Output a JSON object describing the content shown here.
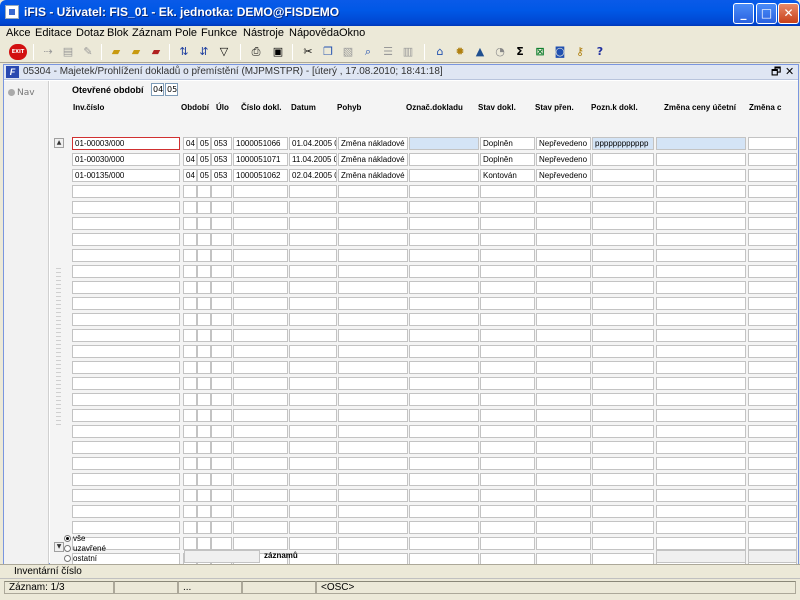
{
  "window": {
    "title": "iFIS - Uživatel: FIS_01 - Ek. jednotka: DEMO@FISDEMO",
    "minimize": "_",
    "maximize": "□",
    "close": "✕"
  },
  "menu": [
    "Akce",
    "Editace",
    "Dotaz",
    "Blok",
    "Záznam",
    "Pole",
    "Funkce",
    "Nástroje",
    "Nápověda",
    "Okno"
  ],
  "toolbar": {
    "exit_label": "EXIT",
    "icons": [
      "exit-icon",
      "import-icon",
      "print-preview-icon",
      "clear-icon",
      "folder-save-icon",
      "folder-lock-icon",
      "folder-delete-icon",
      "sort-ascending-icon",
      "sort-descending-icon",
      "filter-icon",
      "printer-icon",
      "save-icon",
      "cut-icon",
      "copy-icon",
      "paste-icon",
      "search-icon",
      "list-icon",
      "column-icon",
      "tree-icon",
      "settings-icon",
      "triangle-icon",
      "clock-icon",
      "sum-icon",
      "excel-icon",
      "refresh-icon",
      "key-icon",
      "help-icon"
    ],
    "sum_label": "Σ",
    "help_label": "?"
  },
  "form": {
    "title": "05304 - Majetek/Prohlížení dokladů o přemístění (MJPMSTPR) - [úterý , 17.08.2010; 18:41:18]",
    "nav_label": "Nav",
    "period_label": "Otevřené období",
    "period_values": [
      "04",
      "05"
    ],
    "restore_icon": "🗗",
    "close_icon": "✕"
  },
  "table": {
    "columns": [
      "Inv.číslo",
      "Období",
      "Úlo",
      "Číslo dokl.",
      "Datum",
      "Pohyb",
      "Označ.dokladu",
      "Stav dokl.",
      "Stav přen.",
      "Pozn.k dokl.",
      "Změna ceny účetní",
      "Změna c"
    ],
    "rows": [
      [
        "01-00003/000",
        "04",
        "05",
        "053",
        "1000051066",
        "01.04.2005 0",
        "Změna nákladové",
        "",
        "Doplněn",
        "Nepřevedeno",
        "pppppppppppp",
        ""
      ],
      [
        "01-00030/000",
        "04",
        "05",
        "053",
        "1000051071",
        "11.04.2005 0",
        "Změna nákladové",
        "",
        "Doplněn",
        "Nepřevedeno",
        "",
        ""
      ],
      [
        "01-00135/000",
        "04",
        "05",
        "053",
        "1000051062",
        "02.04.2005 0",
        "Změna nákladové",
        "",
        "Kontován",
        "Nepřevedeno",
        "",
        ""
      ]
    ],
    "empty_rows": 25
  },
  "filter": {
    "options": [
      {
        "label": "vše",
        "selected": true
      },
      {
        "label": "uzavřené",
        "selected": false
      },
      {
        "label": "ostatní",
        "selected": false
      }
    ],
    "records_label": "záznamů"
  },
  "status": {
    "hint": "Inventární číslo",
    "record": "Záznam: 1/3",
    "ellipsis": "...",
    "mode": "<OSC>"
  }
}
